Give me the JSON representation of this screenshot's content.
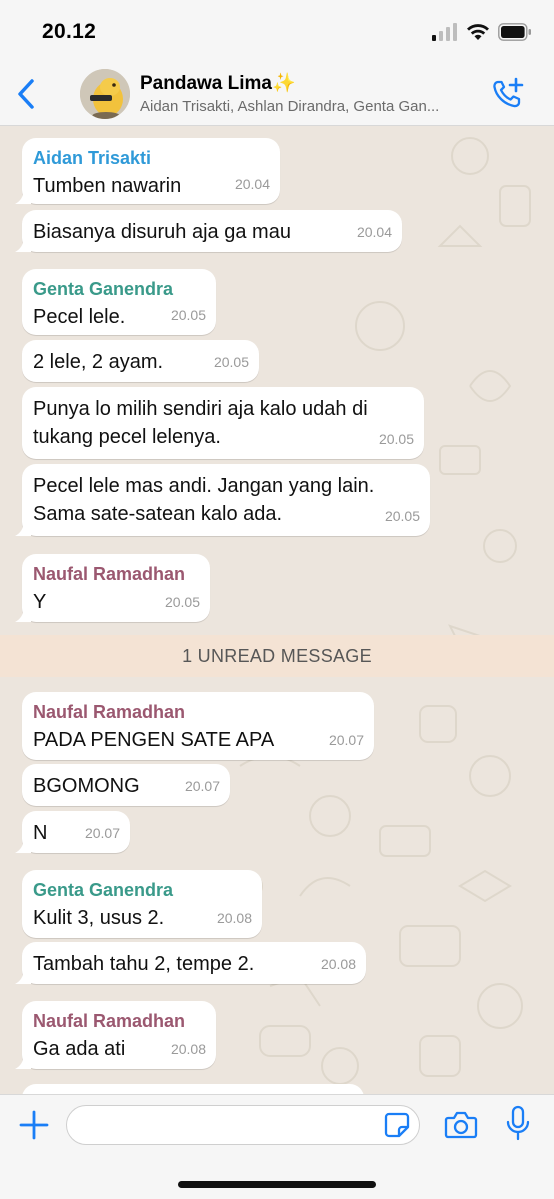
{
  "status_bar": {
    "time": "20.12"
  },
  "header": {
    "title": "Pandawa Lima✨",
    "subtitle": "Aidan Trisakti, Ashlan Dirandra, Genta Gan..."
  },
  "colors": {
    "accent": "#1a7ef6",
    "sender_aidan": "#2f9ad8",
    "sender_genta": "#3a9a8a",
    "sender_naufal": "#9b5870",
    "unread_bar": "#f4e3d4"
  },
  "messages": [
    {
      "sender": "Aidan Trisakti",
      "text": "Tumben nawarin",
      "time": "20.04"
    },
    {
      "text": "Biasanya disuruh aja ga mau",
      "time": "20.04"
    },
    {
      "sender": "Genta Ganendra",
      "text": "Pecel lele.",
      "time": "20.05"
    },
    {
      "text": "2 lele, 2 ayam.",
      "time": "20.05"
    },
    {
      "text": "Punya lo milih sendiri aja kalo udah di tukang pecel lelenya.",
      "time": "20.05"
    },
    {
      "text": "Pecel lele mas andi. Jangan yang lain. Sama sate-satean kalo ada.",
      "time": "20.05"
    },
    {
      "sender": "Naufal Ramadhan",
      "text": "Y",
      "time": "20.05"
    },
    {
      "sender": "Naufal Ramadhan",
      "text": "PADA PENGEN SATE APA",
      "time": "20.07"
    },
    {
      "text": "BGOMONG",
      "time": "20.07"
    },
    {
      "text": "N",
      "time": "20.07"
    },
    {
      "sender": "Genta Ganendra",
      "text": "Kulit 3, usus 2.",
      "time": "20.08"
    },
    {
      "text": "Tambah tahu 2, tempe 2.",
      "time": "20.08"
    },
    {
      "sender": "Naufal Ramadhan",
      "text": "Ga ada ati",
      "time": "20.08"
    }
  ],
  "unread_banner": "1 UNREAD MESSAGE",
  "input": {
    "value": "",
    "placeholder": ""
  },
  "icons": {
    "back": "chevron-left-icon",
    "add_call": "phone-plus-icon",
    "plus": "plus-icon",
    "sticker": "sticker-icon",
    "camera": "camera-icon",
    "mic": "microphone-icon"
  }
}
